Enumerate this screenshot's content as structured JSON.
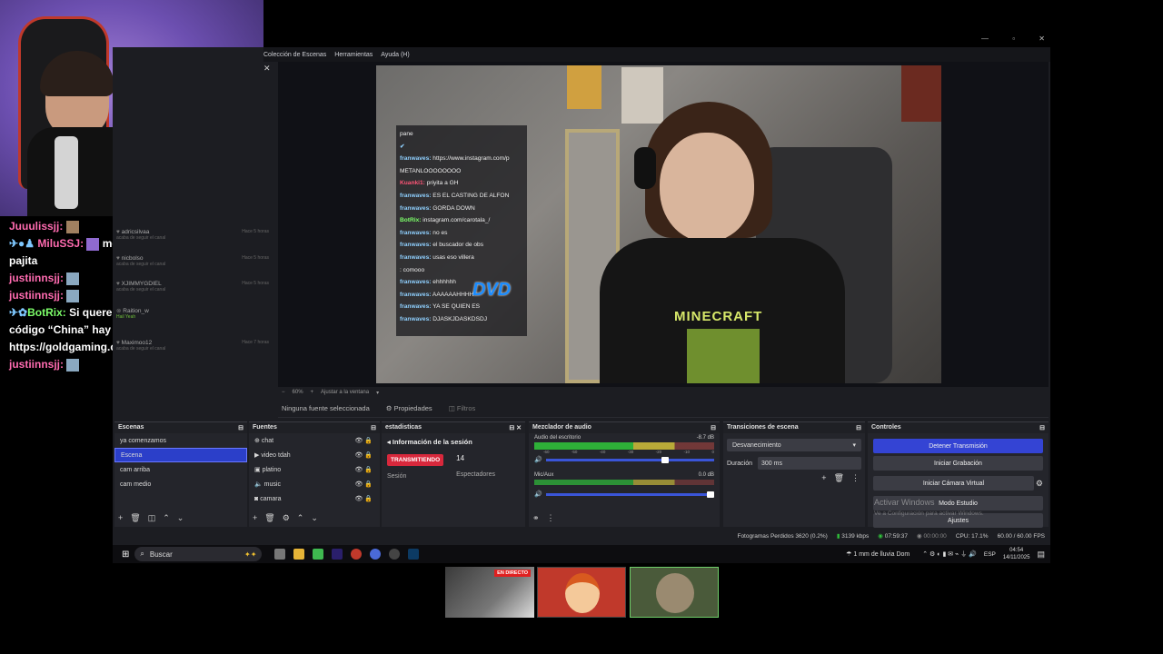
{
  "menu": {
    "items": [
      "Colección de Escenas",
      "Herramientas",
      "Ayuda (H)"
    ]
  },
  "window_controls": {
    "minimize": "—",
    "maximize": "▫",
    "close": "✕"
  },
  "preview": {
    "chat_overlay": [
      {
        "user": "pane",
        "text": ""
      },
      {
        "user": "✔",
        "text": ""
      },
      {
        "user": "franwaves:",
        "text": "https://www.instagram.com/p"
      },
      {
        "user": "",
        "text": "METANLOOOOOOOO"
      },
      {
        "user": "Kuanki1:",
        "text": "priyita a GH"
      },
      {
        "user": "franwaves:",
        "text": "ES EL CASTING DE ALFON"
      },
      {
        "user": "franwaves:",
        "text": "GORDA DOWN"
      },
      {
        "user": "BotRix:",
        "text": "instagram.com/carotala_/"
      },
      {
        "user": "franwaves:",
        "text": "no es"
      },
      {
        "user": "franwaves:",
        "text": "el buscador de obs"
      },
      {
        "user": "franwaves:",
        "text": "usas eso villera"
      },
      {
        "user": "",
        "text": ": comooo"
      },
      {
        "user": "franwaves:",
        "text": "ehhhhhh"
      },
      {
        "user": "franwaves:",
        "text": "AAAAAAHHHH"
      },
      {
        "user": "franwaves:",
        "text": "YA SE QUIEN ES"
      },
      {
        "user": "franwaves:",
        "text": "DJASKJDASKDSDJ"
      }
    ],
    "dvd_logo": "DVD",
    "shirt_text": "MINECRAFT"
  },
  "zoom": {
    "level": "60%",
    "fit_label": "Ajustar a la ventana"
  },
  "props_bar": {
    "no_source": "Ninguna fuente seleccionada",
    "properties": "Propiedades",
    "filters": "Filtros"
  },
  "docks": {
    "scenes": {
      "title": "Escenas",
      "items": [
        "ya comenzamos",
        "Escena",
        "cam arriba",
        "cam medio"
      ],
      "selected": 1
    },
    "sources": {
      "title": "Fuentes",
      "items": [
        "chat",
        "video tdah",
        "platino",
        "music",
        "camara"
      ]
    },
    "stats": {
      "title": "estadisticas",
      "session_info": "Información de la sesión",
      "live_badge": "TRANSMITIENDO",
      "session_label": "Sesión",
      "viewers_count": "14",
      "viewers_label": "Espectadores"
    },
    "mixer": {
      "title": "Mezclador de audio",
      "channels": [
        {
          "name": "Audio del escritorio",
          "db": "-8.7 dB"
        },
        {
          "name": "Mic/Aux",
          "db": "0.0 dB"
        }
      ],
      "scale": [
        "-60",
        "-55",
        "-50",
        "-45",
        "-40",
        "-35",
        "-30",
        "-25",
        "-20",
        "-15",
        "-10",
        "-5",
        "0"
      ]
    },
    "transitions": {
      "title": "Transiciones de escena",
      "selected": "Desvanecimiento",
      "duration_label": "Duración",
      "duration_value": "300 ms"
    },
    "controls": {
      "title": "Controles",
      "stop_stream": "Detener Transmisión",
      "start_record": "Iniciar Grabación",
      "virtual_cam": "Iniciar Cámara Virtual",
      "studio_mode": "Modo Estudio",
      "settings": "Ajustes",
      "activate_title": "Activar Windows",
      "activate_sub": "Ve a Configuración para activar Windows."
    }
  },
  "status_bar": {
    "dropped": "Fotogramas Perdidos 3620 (0.2%)",
    "bitrate": "3139 kbps",
    "stream_time": "07:59:37",
    "rec_time": "00:00:00",
    "cpu": "CPU: 17.1%",
    "fps": "60.00 / 60.00 FPS"
  },
  "taskbar": {
    "search_placeholder": "Buscar",
    "weather": "1 mm de lluvia Dom",
    "lang": "ESP",
    "time": "04:54",
    "date": "14/11/2025"
  },
  "left_chat": [
    {
      "name": "Juuulissjj:",
      "text": "",
      "emote": true
    },
    {
      "name": "MiluSSJ:",
      "text": "me conseguís un saludo de pajita",
      "emote": true
    },
    {
      "name": "justiinnsjj:",
      "text": "",
      "emote": true
    },
    {
      "name": "justiinnsjj:",
      "text": "",
      "emote": true
    },
    {
      "name": "BotRix:",
      "text": "Si queres mejorar tu Set-up Con el código “China” hay DESCUENTOS en https://goldgaming.com.ar/",
      "emote": false
    },
    {
      "name": "justiinnsjj:",
      "text": "",
      "emote": true
    }
  ],
  "activity_feed": [
    {
      "user": "adricsilvaa",
      "sub": "acaba de seguir el canal",
      "time": "Hace 5 horas"
    },
    {
      "user": "nicbolso",
      "sub": "acaba de seguir el canal",
      "time": "Hace 5 horas"
    },
    {
      "user": "XJIMMYGDIEL",
      "sub": "acaba de seguir el canal",
      "time": "Hace 5 horas"
    },
    {
      "user": "Raition_w",
      "sub": "Hail Yeah",
      "time": ""
    },
    {
      "user": "Maximoo12",
      "sub": "acaba de seguir el canal",
      "time": "Hace 7 horas"
    }
  ],
  "thumbs": {
    "live_badge": "EN DIRECTO"
  }
}
